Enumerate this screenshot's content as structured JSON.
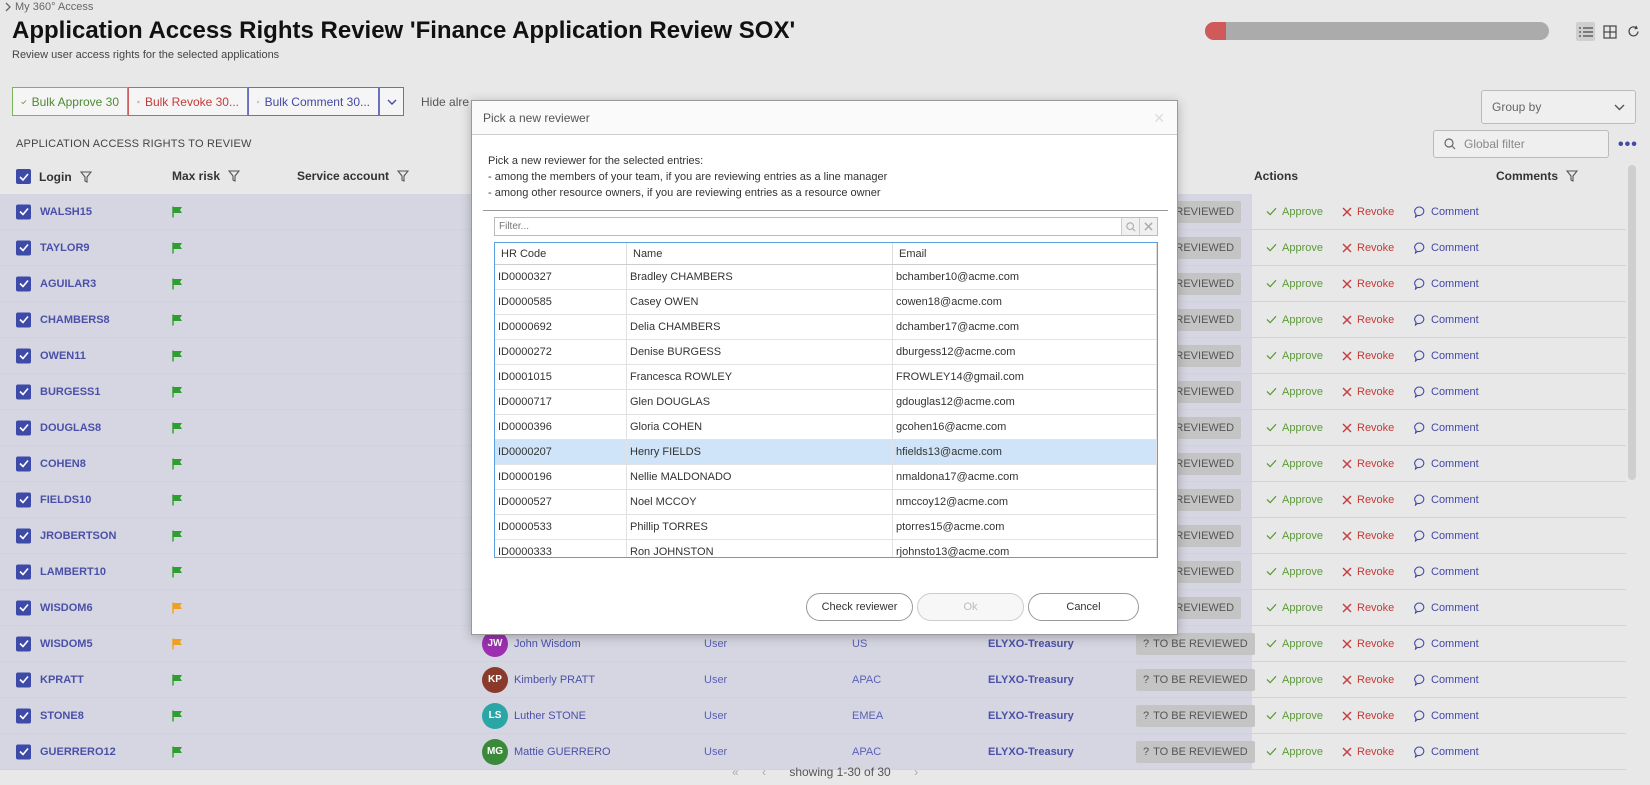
{
  "breadcrumb": "My 360° Access",
  "title": "Application Access Rights Review 'Finance Application Review SOX'",
  "subtitle": "Review user access rights for the selected applications",
  "progress": 0.06,
  "toolbar": {
    "bulk_approve": "Bulk Approve 30",
    "bulk_revoke": "Bulk Revoke 30...",
    "bulk_comment": "Bulk Comment 30...",
    "hide_label": "Hide alre"
  },
  "group_by": "Group by",
  "section_title": "APPLICATION ACCESS RIGHTS TO REVIEW",
  "global_filter_placeholder": "Global filter",
  "columns": {
    "login": "Login",
    "max_risk": "Max risk",
    "service_account": "Service account",
    "actions": "Actions",
    "comments": "Comments"
  },
  "actions": {
    "approve": "Approve",
    "revoke": "Revoke",
    "comment": "Comment"
  },
  "status_text": "TO BE REVIEWED",
  "status_text_clipped": "E REVIEWED",
  "colors": {
    "flag_green": "#2e9e2e",
    "flag_orange": "#f0a020",
    "accent": "#3e4aa8"
  },
  "rows": [
    {
      "login": "WALSH15",
      "flag": "green"
    },
    {
      "login": "TAYLOR9",
      "flag": "green"
    },
    {
      "login": "AGUILAR3",
      "flag": "green"
    },
    {
      "login": "CHAMBERS8",
      "flag": "green"
    },
    {
      "login": "OWEN11",
      "flag": "green"
    },
    {
      "login": "BURGESS1",
      "flag": "green"
    },
    {
      "login": "DOUGLAS8",
      "flag": "green"
    },
    {
      "login": "COHEN8",
      "flag": "green"
    },
    {
      "login": "FIELDS10",
      "flag": "green"
    },
    {
      "login": "JROBERTSON",
      "flag": "green"
    },
    {
      "login": "LAMBERT10",
      "flag": "green"
    },
    {
      "login": "WISDOM6",
      "flag": "orange"
    },
    {
      "login": "WISDOM5",
      "flag": "orange",
      "initials": "JW",
      "avatar_color": "#9c2fb0",
      "person": "John Wisdom",
      "type": "User",
      "region": "US",
      "app": "ELYXO-Treasury"
    },
    {
      "login": "KPRATT",
      "flag": "green",
      "initials": "KP",
      "avatar_color": "#8a3a2a",
      "person": "Kimberly PRATT",
      "type": "User",
      "region": "APAC",
      "app": "ELYXO-Treasury"
    },
    {
      "login": "STONE8",
      "flag": "green",
      "initials": "LS",
      "avatar_color": "#2aa6a6",
      "person": "Luther STONE",
      "type": "User",
      "region": "EMEA",
      "app": "ELYXO-Treasury"
    },
    {
      "login": "GUERRERO12",
      "flag": "green",
      "initials": "MG",
      "avatar_color": "#3a8a3a",
      "person": "Mattie GUERRERO",
      "type": "User",
      "region": "APAC",
      "app": "ELYXO-Treasury"
    }
  ],
  "pager": {
    "info": "showing 1-30 of 30"
  },
  "modal": {
    "title": "Pick a new reviewer",
    "desc_line1": "Pick a new reviewer for the selected entries:",
    "desc_line2": "- among the members of your team, if you are reviewing entries as a line manager",
    "desc_line3": "- among other resource owners, if you are reviewing entries as a resource owner",
    "filter_placeholder": "Filter...",
    "columns": {
      "hr": "HR Code",
      "name": "Name",
      "email": "Email"
    },
    "rows": [
      {
        "hr": "ID0000327",
        "name": "Bradley CHAMBERS",
        "email": "bchamber10@acme.com"
      },
      {
        "hr": "ID0000585",
        "name": "Casey OWEN",
        "email": "cowen18@acme.com"
      },
      {
        "hr": "ID0000692",
        "name": "Delia CHAMBERS",
        "email": "dchamber17@acme.com"
      },
      {
        "hr": "ID0000272",
        "name": "Denise BURGESS",
        "email": "dburgess12@acme.com"
      },
      {
        "hr": "ID0001015",
        "name": "Francesca ROWLEY",
        "email": "FROWLEY14@gmail.com"
      },
      {
        "hr": "ID0000717",
        "name": "Glen DOUGLAS",
        "email": "gdouglas12@acme.com"
      },
      {
        "hr": "ID0000396",
        "name": "Gloria COHEN",
        "email": "gcohen16@acme.com"
      },
      {
        "hr": "ID0000207",
        "name": "Henry FIELDS",
        "email": "hfields13@acme.com",
        "selected": true
      },
      {
        "hr": "ID0000196",
        "name": "Nellie MALDONADO",
        "email": "nmaldona17@acme.com"
      },
      {
        "hr": "ID0000527",
        "name": "Noel MCCOY",
        "email": "nmccoy12@acme.com"
      },
      {
        "hr": "ID0000533",
        "name": "Phillip TORRES",
        "email": "ptorres15@acme.com"
      },
      {
        "hr": "ID0000333",
        "name": "Ron JOHNSTON",
        "email": "rjohnsto13@acme.com"
      }
    ],
    "check_reviewer": "Check reviewer",
    "ok": "Ok",
    "cancel": "Cancel"
  }
}
